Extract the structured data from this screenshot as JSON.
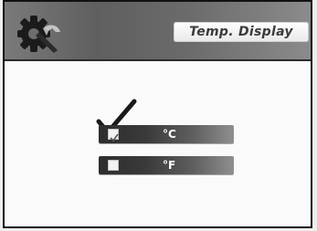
{
  "header": {
    "title": "Temp. Display",
    "icon": "gear-icon"
  },
  "options": [
    {
      "label": "°C",
      "selected": true
    },
    {
      "label": "°F",
      "selected": false
    }
  ],
  "colors": {
    "header_dark": "#5f5f5f",
    "option_dark": "#2d2d2d",
    "screen_bg": "#fafafa"
  }
}
